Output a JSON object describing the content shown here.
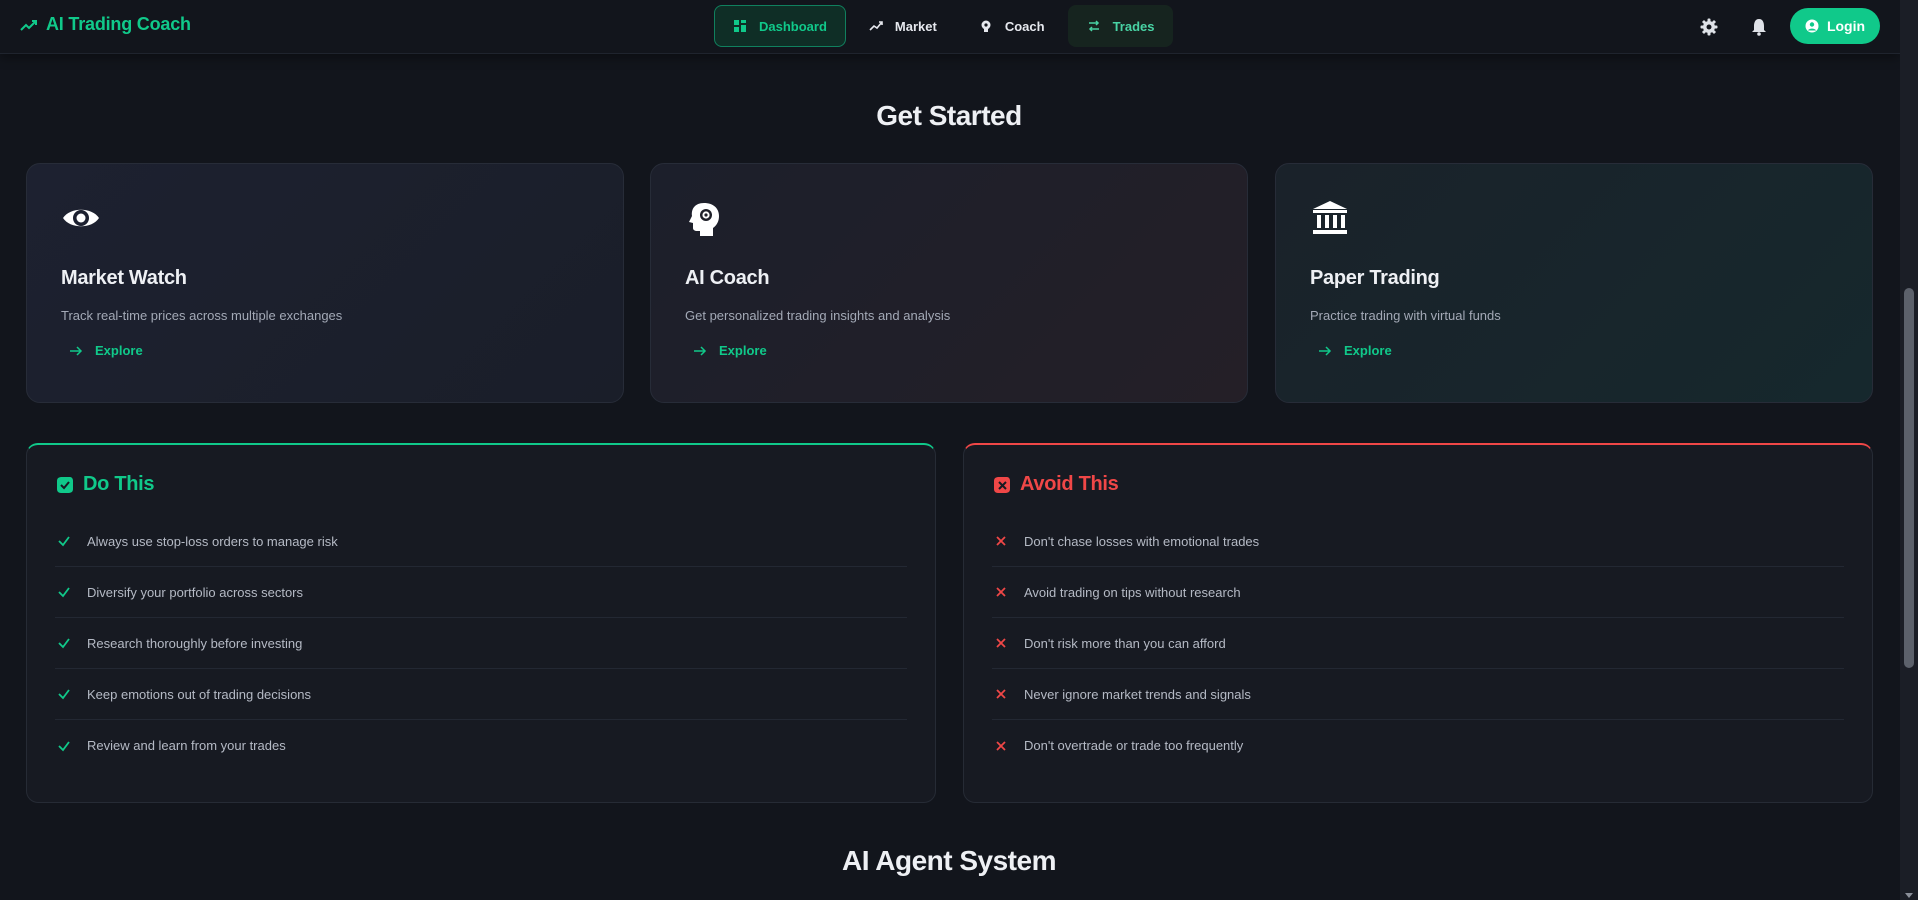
{
  "brand": {
    "name": "AI Trading Coach",
    "icon": "trending-up-icon",
    "color": "#10c98a"
  },
  "nav": {
    "items": [
      {
        "label": "Dashboard",
        "icon": "grid-icon",
        "active": true
      },
      {
        "label": "Market",
        "icon": "trending-up-icon",
        "active": false
      },
      {
        "label": "Coach",
        "icon": "brain-icon",
        "active": false
      },
      {
        "label": "Trades",
        "icon": "swap-icon",
        "active": false
      }
    ]
  },
  "header_tools": {
    "settings_icon": "gear-icon",
    "notifications_icon": "bell-icon",
    "login_label": "Login",
    "login_icon": "user-circle-icon"
  },
  "get_started": {
    "title": "Get Started",
    "cards": [
      {
        "title": "Market Watch",
        "description": "Track real-time prices across multiple exchanges",
        "link": "Explore",
        "icon": "eye-icon"
      },
      {
        "title": "AI Coach",
        "description": "Get personalized trading insights and analysis",
        "link": "Explore",
        "icon": "brain-gear-icon"
      },
      {
        "title": "Paper Trading",
        "description": "Practice trading with virtual funds",
        "link": "Explore",
        "icon": "bank-icon"
      }
    ]
  },
  "do_this": {
    "title": "Do This",
    "color": "#10c98a",
    "items": [
      "Always use stop-loss orders to manage risk",
      "Diversify your portfolio across sectors",
      "Research thoroughly before investing",
      "Keep emotions out of trading decisions",
      "Review and learn from your trades"
    ]
  },
  "avoid_this": {
    "title": "Avoid This",
    "color": "#f04747",
    "items": [
      "Don't chase losses with emotional trades",
      "Avoid trading on tips without research",
      "Don't risk more than you can afford",
      "Never ignore market trends and signals",
      "Don't overtrade or trade too frequently"
    ]
  },
  "agent_section": {
    "title": "AI Agent System"
  }
}
